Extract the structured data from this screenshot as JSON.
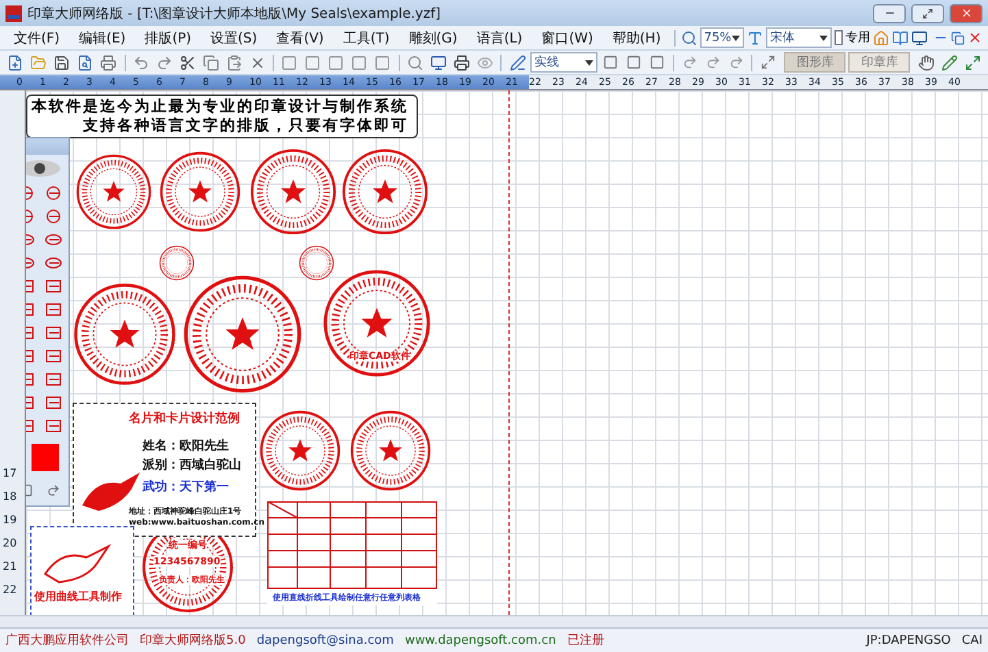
{
  "window": {
    "title": "印章大师网络版 - [T:\\图章设计大师本地版\\My Seals\\example.yzf]"
  },
  "menu": [
    "文件(F)",
    "编辑(E)",
    "排版(P)",
    "设置(S)",
    "查看(V)",
    "工具(T)",
    "雕刻(G)",
    "语言(L)",
    "窗口(W)",
    "帮助(H)"
  ],
  "zoom": {
    "value": "75%"
  },
  "font": {
    "value": "宋体"
  },
  "special": {
    "label": "专用",
    "checked": false
  },
  "line_style": {
    "value": "实线"
  },
  "library_tabs": [
    {
      "label": "图形库",
      "selected": true
    },
    {
      "label": "印章库",
      "selected": false
    }
  ],
  "ruler": {
    "horizontal": [
      "0",
      "1",
      "2",
      "3",
      "4",
      "5",
      "6",
      "7",
      "8",
      "9",
      "10",
      "11",
      "12",
      "13",
      "14",
      "15",
      "16",
      "17",
      "18",
      "19",
      "20",
      "21",
      "22",
      "23",
      "24",
      "25",
      "26",
      "27",
      "28",
      "29",
      "30",
      "31",
      "32",
      "33",
      "34",
      "35",
      "36",
      "37",
      "38",
      "39",
      "40"
    ],
    "vertical": [
      "17",
      "18",
      "19",
      "20",
      "21",
      "22"
    ]
  },
  "canvas": {
    "banner": [
      "本软件是迄今为止最为专业的印章设计与制作系统",
      "支持各种语言文字的排版，只要有字体即可"
    ],
    "seal_label": "印章CAD软件",
    "card": {
      "title": "名片和卡片设计范例",
      "lines": [
        "姓名：欧阳先生",
        "派别：西域白驼山"
      ],
      "motto": "武功：天下第一",
      "address": "地址：西域神驼峰白驼山庄1号",
      "url": "web:www.baituoshan.com.cn"
    },
    "curve_caption": "使用曲线工具制作",
    "number_seal": {
      "heading": "统一编号",
      "number": "1234567890",
      "person": "负责人：欧阳先生"
    },
    "table_caption": "使用直线折线工具绘制任意行任意列表格"
  },
  "palette": {
    "color": "#ff0000"
  },
  "status_bar": [
    "广西大鹏应用软件公司",
    "印章大师网络版5.0",
    "dapengsoft@sina.com",
    "www.dapengsoft.com.cn",
    "已注册",
    "JP:DAPENGSO",
    "CAI"
  ]
}
